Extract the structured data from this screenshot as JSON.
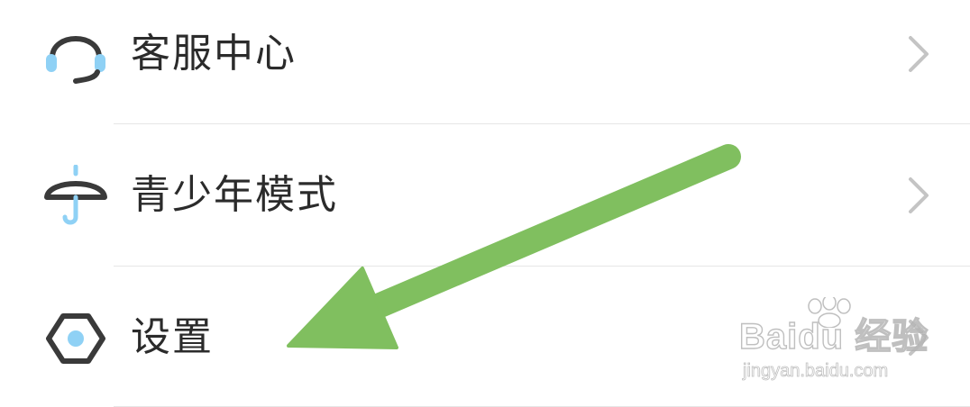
{
  "menu": {
    "items": [
      {
        "label": "客服中心",
        "icon": "headset-icon"
      },
      {
        "label": "青少年模式",
        "icon": "umbrella-icon"
      },
      {
        "label": "设置",
        "icon": "settings-hexagon-icon"
      }
    ],
    "chevron_icon": "chevron-right-icon"
  },
  "annotation": {
    "arrow_color": "#80bf5f",
    "arrow_target": "设置"
  },
  "watermark": {
    "brand": "Baidu 经验",
    "url": "jingyan.baidu.com"
  },
  "colors": {
    "icon_dark": "#3a3a3a",
    "icon_accent": "#8fd1f5",
    "chevron": "#c4c4c4",
    "divider": "#e6e6e6"
  }
}
